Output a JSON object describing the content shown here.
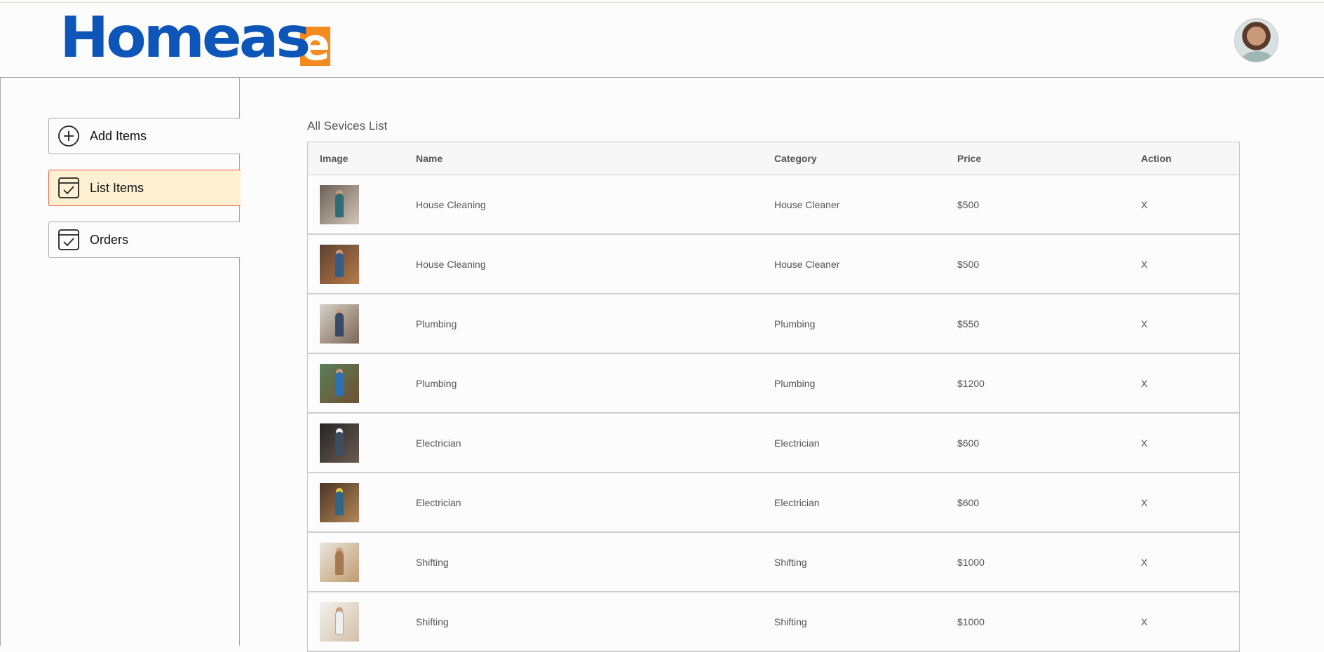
{
  "brand": {
    "logo_main": "Homeas",
    "logo_accent": "e"
  },
  "sidebar": {
    "items": [
      {
        "label": "Add Items",
        "icon": "add-circle-icon"
      },
      {
        "label": "List Items",
        "icon": "checkbox-window-icon",
        "active": true
      },
      {
        "label": "Orders",
        "icon": "checkbox-window-icon"
      }
    ]
  },
  "main": {
    "title": "All Sevices List",
    "columns": [
      "Image",
      "Name",
      "Category",
      "Price",
      "Action"
    ],
    "rows": [
      {
        "name": "House Cleaning",
        "category": "House Cleaner",
        "price": "$500",
        "action": "X"
      },
      {
        "name": "House Cleaning",
        "category": "House Cleaner",
        "price": "$500",
        "action": "X"
      },
      {
        "name": "Plumbing",
        "category": "Plumbing",
        "price": "$550",
        "action": "X"
      },
      {
        "name": "Plumbing",
        "category": "Plumbing",
        "price": "$1200",
        "action": "X"
      },
      {
        "name": "Electrician",
        "category": "Electrician",
        "price": "$600",
        "action": "X"
      },
      {
        "name": "Electrician",
        "category": "Electrician",
        "price": "$600",
        "action": "X"
      },
      {
        "name": "Shifting",
        "category": "Shifting",
        "price": "$1000",
        "action": "X"
      },
      {
        "name": "Shifting",
        "category": "Shifting",
        "price": "$1000",
        "action": "X"
      }
    ]
  },
  "colors": {
    "brand_blue": "#0d55b8",
    "brand_orange": "#f48b1f",
    "active_bg": "#fff0d2",
    "active_border": "#e35a3c"
  }
}
